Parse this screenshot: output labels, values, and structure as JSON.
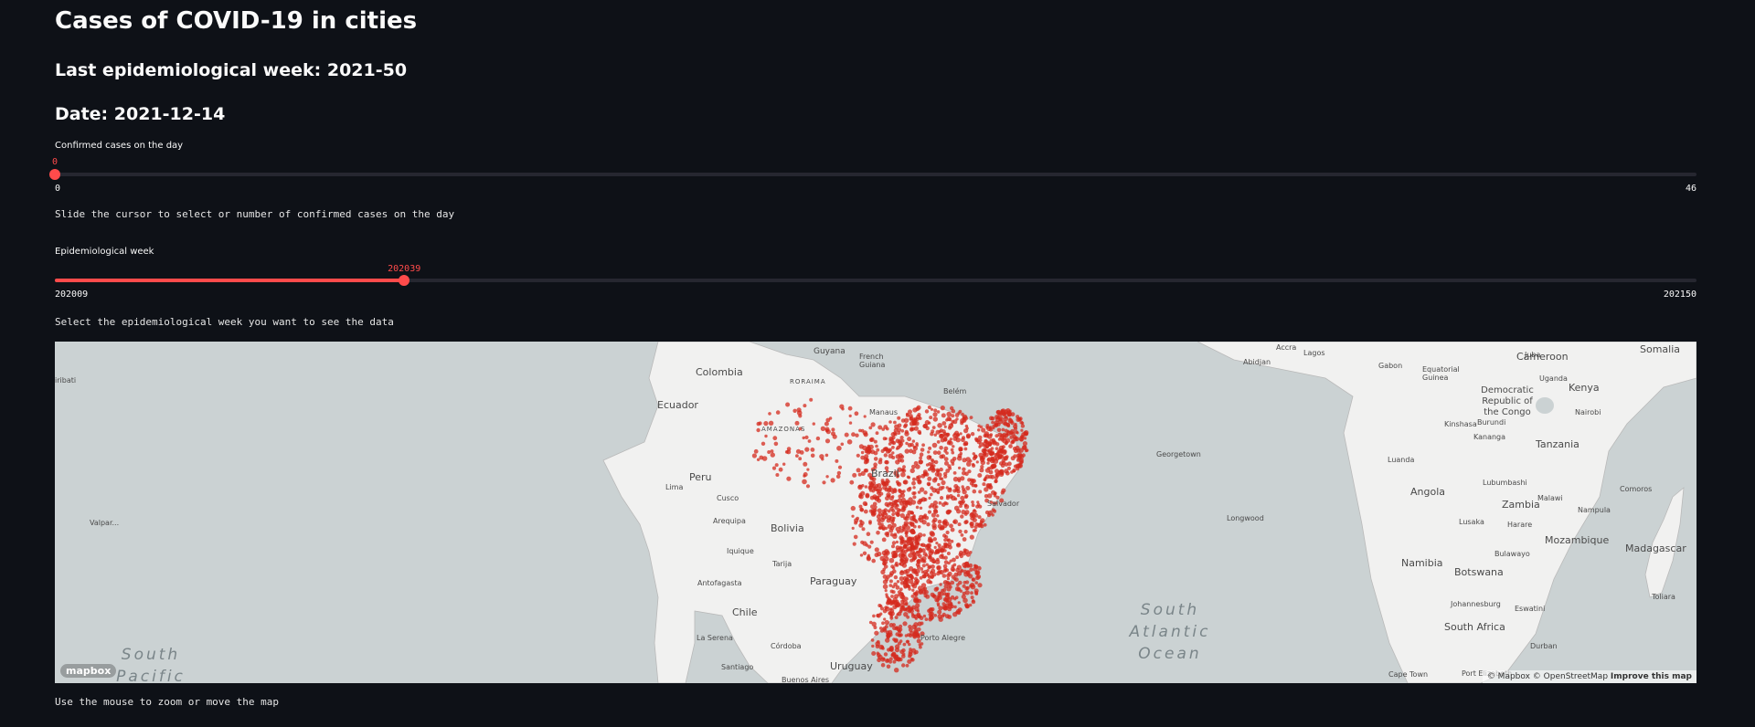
{
  "title": "Cases of COVID-19 in cities",
  "last_week_label": "Last epidemiological week: 2021-50",
  "date_label": "Date: 2021-12-14",
  "slider_cases": {
    "label": "Confirmed cases on the day",
    "value": 0,
    "value_text": "0",
    "min": 0,
    "max": 46,
    "min_text": "0",
    "max_text": "46",
    "help": "Slide the cursor to select or number of confirmed cases on the day"
  },
  "slider_week": {
    "label": "Epidemiological week",
    "value_fraction": 0.2128,
    "value_text": "202039",
    "min_text": "202009",
    "max_text": "202150",
    "help": "Select the epidemiological week you want to see the data"
  },
  "map": {
    "labels": {
      "colombia": "Colombia",
      "ecuador": "Ecuador",
      "peru": "Peru",
      "bolivia": "Bolivia",
      "brazil": "Brazil",
      "paraguay": "Paraguay",
      "chile": "Chile",
      "uruguay": "Uruguay",
      "guyana": "Guyana",
      "french_guiana": "French Guiana",
      "lima": "Lima",
      "cusco": "Cusco",
      "arequipa": "Arequipa",
      "salvador": "Salvador",
      "cordoba": "Córdoba",
      "la_serena": "La Serena",
      "santiago": "Santiago",
      "buenos_aires": "Buenos Aires",
      "porto_alegre": "Porto Alegre",
      "georgetown": "Georgetown",
      "longwood": "Longwood",
      "cameroon": "Cameroon",
      "drc": "Democratic Republic of the Congo",
      "kenya": "Kenya",
      "somalia": "Somalia",
      "tanzania": "Tanzania",
      "angola": "Angola",
      "zambia": "Zambia",
      "mozambique": "Mozambique",
      "madagascar": "Madagascar",
      "namibia": "Namibia",
      "botswana": "Botswana",
      "south_africa": "South Africa",
      "malawi": "Malawi",
      "luanda": "Luanda",
      "lubumbashi": "Lubumbashi",
      "kinshasa": "Kinshasa",
      "nairobi": "Nairobi",
      "johannesburg": "Johannesburg",
      "durban": "Durban",
      "cape_town": "Cape Town",
      "port_elizabeth": "Port Elizabeth",
      "abidjan": "Abidjan",
      "accra": "Accra",
      "lagos": "Lagos",
      "uganda": "Uganda",
      "juba": "Juba",
      "comoros": "Comoros",
      "toliara": "Toliara",
      "lusaka": "Lusaka",
      "harare": "Harare",
      "bulawayo": "Bulawayo",
      "nampula": "Nampula",
      "eswatini": "Eswatini",
      "kananga": "Kananga",
      "equatorial_guinea": "Equatorial Guinea",
      "burundi": "Burundi",
      "valpo": "Valpar...",
      "south_atlantic": "South Atlantic Ocean",
      "south_pacific": "South Pacific",
      "kiribati": "iribati",
      "amazonas": "AMAZONAS",
      "roraima": "RORAIMA",
      "manaus": "Manaus",
      "belem": "Belém",
      "antofagasta": "Antofagasta",
      "iquique": "Iquique",
      "tarija": "Tarija",
      "gabon": "Gabon"
    },
    "attribution": "© Mapbox © OpenStreetMap",
    "improve_link": "Improve this map",
    "logo": "mapbox",
    "dot_color": "#d42a1e",
    "land_color": "#f1f1f0",
    "water_color": "#cbd2d3"
  },
  "map_help": "Use the mouse to zoom or move the map"
}
